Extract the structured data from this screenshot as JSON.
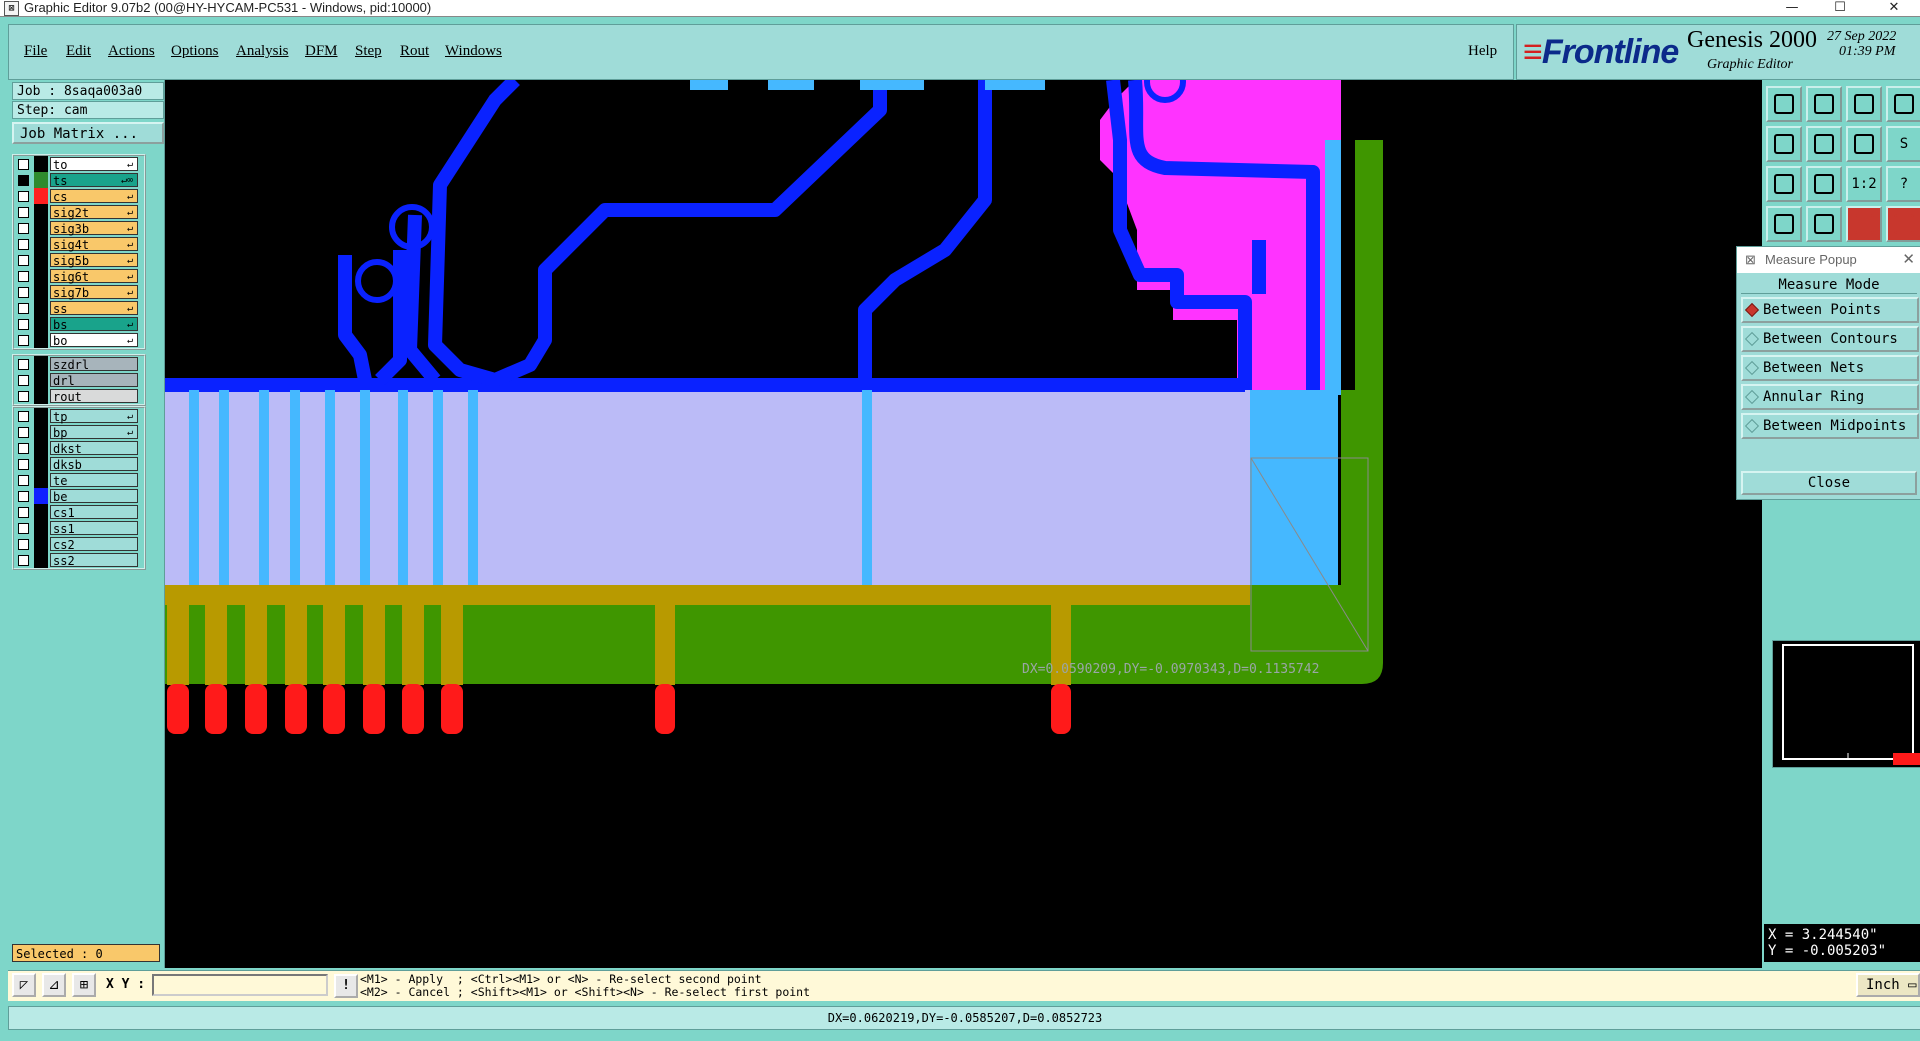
{
  "window": {
    "title": "Graphic Editor 9.07b2 (00@HY-HYCAM-PC531 - Windows, pid:10000)",
    "controls": [
      "—",
      "☐",
      "✕"
    ]
  },
  "menu": {
    "items": [
      "File",
      "Edit",
      "Actions",
      "Options",
      "Analysis",
      "DFM",
      "Step",
      "Rout",
      "Windows"
    ],
    "help": "Help"
  },
  "brand": {
    "logo_f": "F",
    "logo_rest": "rontline",
    "product": "Genesis 2000",
    "subtitle": "Graphic Editor",
    "date": "27 Sep 2022",
    "time": "01:39 PM"
  },
  "job": {
    "job_line": "Job : 8saqa003a0",
    "step_line": "Step: cam",
    "matrix_button": "Job Matrix ..."
  },
  "layers": {
    "group1": [
      {
        "name": "to",
        "swatch": "#000000",
        "bg": "#ffffff",
        "checked": false,
        "flag": "↵"
      },
      {
        "name": "ts",
        "swatch": "#2e8b2e",
        "bg": "#19a38b",
        "checked": true,
        "flag": "↵∞"
      },
      {
        "name": "cs",
        "swatch": "#ff2020",
        "bg": "#f9c86a",
        "checked": false,
        "flag": "↵"
      },
      {
        "name": "sig2t",
        "swatch": "#000000",
        "bg": "#f9c86a",
        "checked": false,
        "flag": "↵"
      },
      {
        "name": "sig3b",
        "swatch": "#000000",
        "bg": "#f9c86a",
        "checked": false,
        "flag": "↵"
      },
      {
        "name": "sig4t",
        "swatch": "#000000",
        "bg": "#f9c86a",
        "checked": false,
        "flag": "↵"
      },
      {
        "name": "sig5b",
        "swatch": "#000000",
        "bg": "#f9c86a",
        "checked": false,
        "flag": "↵"
      },
      {
        "name": "sig6t",
        "swatch": "#000000",
        "bg": "#f9c86a",
        "checked": false,
        "flag": "↵"
      },
      {
        "name": "sig7b",
        "swatch": "#000000",
        "bg": "#f9c86a",
        "checked": false,
        "flag": "↵"
      },
      {
        "name": "ss",
        "swatch": "#000000",
        "bg": "#f9c86a",
        "checked": false,
        "flag": "↵"
      },
      {
        "name": "bs",
        "swatch": "#000000",
        "bg": "#19a38b",
        "checked": false,
        "flag": "↵"
      },
      {
        "name": "bo",
        "swatch": "#000000",
        "bg": "#ffffff",
        "checked": false,
        "flag": "↵"
      }
    ],
    "group2": [
      {
        "name": "szdrl",
        "swatch": "#000000",
        "bg": "#a7b4bb",
        "checked": false,
        "flag": ""
      },
      {
        "name": "drl",
        "swatch": "#000000",
        "bg": "#a7b4bb",
        "checked": false,
        "flag": ""
      },
      {
        "name": "rout",
        "swatch": "#000000",
        "bg": "#d9dada",
        "checked": false,
        "flag": ""
      }
    ],
    "group3": [
      {
        "name": "tp",
        "swatch": "#000000",
        "bg": "#9fdcd8",
        "checked": false,
        "flag": "↵"
      },
      {
        "name": "bp",
        "swatch": "#000000",
        "bg": "#9fdcd8",
        "checked": false,
        "flag": "↵"
      },
      {
        "name": "dkst",
        "swatch": "#000000",
        "bg": "#9fdcd8",
        "checked": false,
        "flag": ""
      },
      {
        "name": "dksb",
        "swatch": "#000000",
        "bg": "#9fdcd8",
        "checked": false,
        "flag": ""
      },
      {
        "name": "te",
        "swatch": "#000000",
        "bg": "#9fdcd8",
        "checked": false,
        "flag": ""
      },
      {
        "name": "be",
        "swatch": "#1020ff",
        "bg": "#9fdcd8",
        "checked": false,
        "flag": ""
      },
      {
        "name": "cs1",
        "swatch": "#000000",
        "bg": "#9fdcd8",
        "checked": false,
        "flag": ""
      },
      {
        "name": "ss1",
        "swatch": "#000000",
        "bg": "#9fdcd8",
        "checked": false,
        "flag": ""
      },
      {
        "name": "cs2",
        "swatch": "#000000",
        "bg": "#9fdcd8",
        "checked": false,
        "flag": ""
      },
      {
        "name": "ss2",
        "swatch": "#000000",
        "bg": "#9fdcd8",
        "checked": false,
        "flag": ""
      }
    ]
  },
  "selected": "Selected : 0",
  "canvas": {
    "measure_label": "DX=0.0590209,DY=-0.0970343,D=0.1135742",
    "colors": {
      "copper": "#ff33ff",
      "trace": "#0a22ff",
      "mask": "#bbbbf7",
      "light_blue": "#45b8ff",
      "green": "#3f9600",
      "gold": "#b89a00",
      "red_pad": "#ff1a1a"
    }
  },
  "toolbar": {
    "icons": [
      "zoom-home-icon",
      "zoom-back-icon",
      "home-icon",
      "frame-icon",
      "pan-left-icon",
      "pan-right-icon",
      "redraw-icon",
      "snap-icon",
      "fit-icon",
      "center-icon",
      "scale-icon",
      "help-icon",
      "measure-icon",
      "grid-icon",
      "netlist-icon",
      "route-icon"
    ],
    "labels": [
      "",
      "",
      "",
      "",
      "",
      "",
      "",
      "S",
      "",
      "",
      "1:2",
      "?",
      "",
      "",
      "",
      ""
    ]
  },
  "measure_popup": {
    "title": "Measure Popup",
    "mode_label": "Measure Mode",
    "options": [
      "Between Points",
      "Between Contours",
      "Between Nets",
      "Annular Ring",
      "Between Midpoints"
    ],
    "selected_index": 0,
    "close_label": "Close"
  },
  "coords": {
    "x": "X =  3.244540\"",
    "y": "Y = -0.005203\""
  },
  "bottom": {
    "xy_label": "X Y :",
    "xy_value": "",
    "bang": "!",
    "hint1": "<M1> - Apply  ; <Ctrl><M1> or <N> - Re-select second point",
    "hint2": "<M2> - Cancel ; <Shift><M1> or <Shift><N> - Re-select first point",
    "unit": "Inch"
  },
  "status": "DX=0.0620219,DY=-0.0585207,D=0.0852723"
}
